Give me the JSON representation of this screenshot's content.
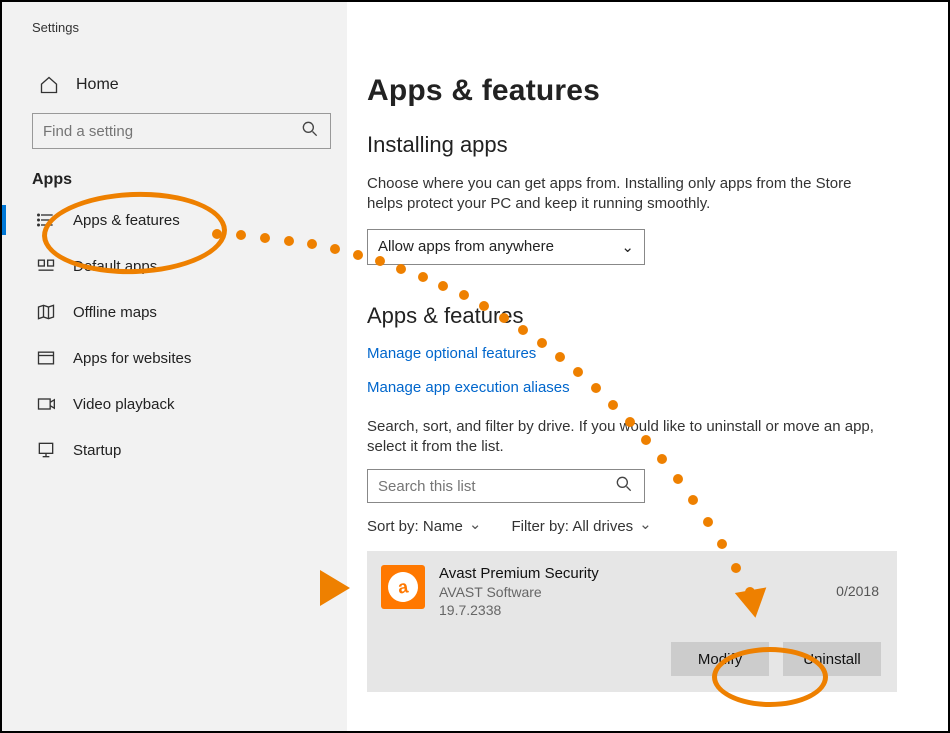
{
  "window_title": "Settings",
  "home_label": "Home",
  "search_placeholder": "Find a setting",
  "section_label": "Apps",
  "nav": [
    {
      "label": "Apps & features"
    },
    {
      "label": "Default apps"
    },
    {
      "label": "Offline maps"
    },
    {
      "label": "Apps for websites"
    },
    {
      "label": "Video playback"
    },
    {
      "label": "Startup"
    }
  ],
  "main": {
    "title": "Apps & features",
    "installing_heading": "Installing apps",
    "installing_desc": "Choose where you can get apps from. Installing only apps from the Store helps protect your PC and keep it running smoothly.",
    "install_source_value": "Allow apps from anywhere",
    "section2_heading": "Apps & features",
    "link_optional": "Manage optional features",
    "link_aliases": "Manage app execution aliases",
    "filter_desc": "Search, sort, and filter by drive. If you would like to uninstall or move an app, select it from the list.",
    "search_list_placeholder": "Search this list",
    "sort_label": "Sort by:",
    "sort_value": "Name",
    "filter_label": "Filter by:",
    "filter_value": "All drives",
    "app": {
      "name": "Avast Premium Security",
      "publisher": "AVAST Software",
      "version": "19.7.2338",
      "date": "0/2018",
      "modify_label": "Modify",
      "uninstall_label": "Uninstall"
    }
  }
}
